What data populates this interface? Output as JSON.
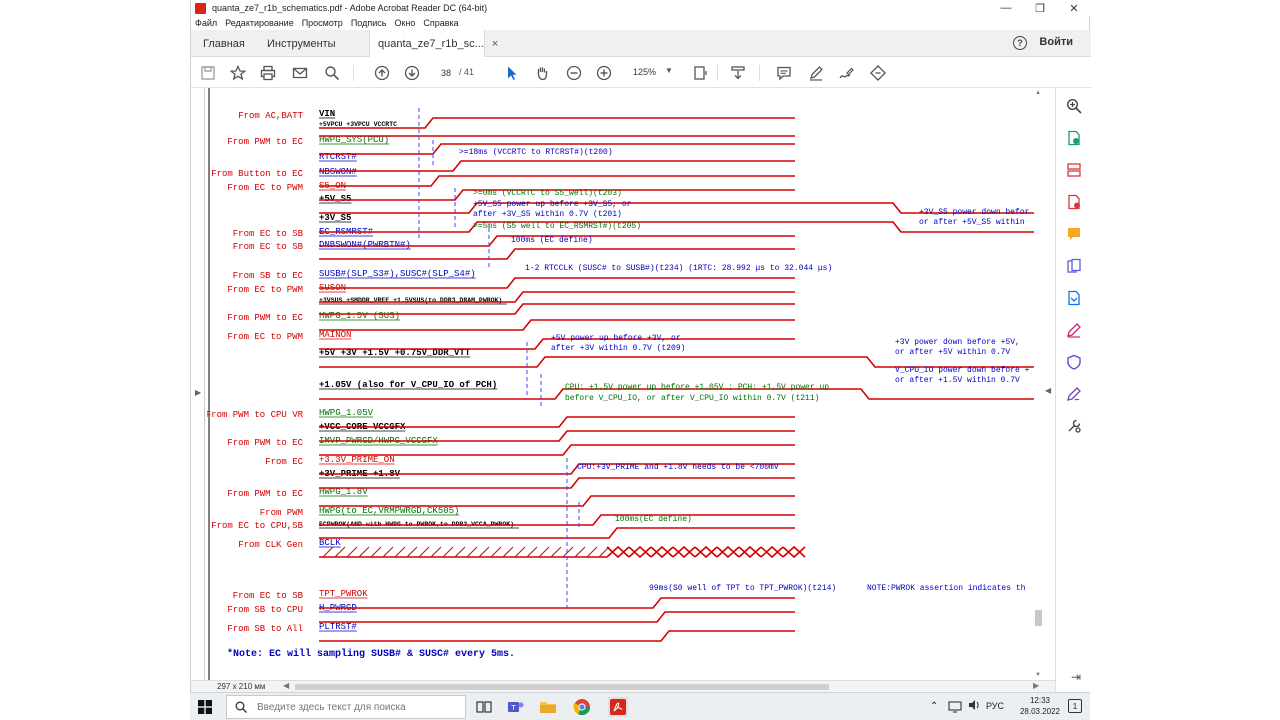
{
  "window": {
    "title": "quanta_ze7_r1b_schematics.pdf - Adobe Acrobat Reader DC (64-bit)",
    "controls": {
      "minimize": "—",
      "maximize": "❐",
      "close": "✕"
    }
  },
  "menu": [
    "Файл",
    "Редактирование",
    "Просмотр",
    "Подпись",
    "Окно",
    "Справка"
  ],
  "tabs": {
    "home": "Главная",
    "tools": "Инструменты",
    "document": "quanta_ze7_r1b_sc...",
    "close": "×",
    "help": "?",
    "signin": "Войти"
  },
  "toolbar": {
    "page_current": "38",
    "page_total": "/ 41",
    "zoom": "125%"
  },
  "schematic": {
    "signals": [
      {
        "source": "From AC,BATT",
        "name": "VIN",
        "color": "#000"
      },
      {
        "source": "",
        "name": "+5VPCU +3VPCU VCCRTC",
        "color": "#000",
        "small": true
      },
      {
        "source": "From PWM to EC",
        "name": "HWPG_SYS(PCU)",
        "color": "#007000"
      },
      {
        "source": "",
        "name": "RTCRST#",
        "color": "#0000c0"
      },
      {
        "source": "From Button to EC",
        "name": "NBSWON#",
        "color": "#0000c0"
      },
      {
        "source": "From EC to PWM",
        "name": "S5_ON",
        "color": "#d40000"
      },
      {
        "source": "",
        "name": "+5V_S5",
        "color": "#000"
      },
      {
        "source": "",
        "name": "+3V_S5",
        "color": "#000"
      },
      {
        "source": "From EC to SB",
        "name": "EC_RSMRST#",
        "color": "#0000c0"
      },
      {
        "source": "From EC to SB",
        "name": "DNBSWON#(PWRBTN#)",
        "color": "#0000c0"
      },
      {
        "source": "From SB to EC",
        "name": "SUSB#(SLP_S3#),SUSC#(SLP_S4#)",
        "color": "#0000c0"
      },
      {
        "source": "From EC to PWM",
        "name": "SUSON",
        "color": "#d40000"
      },
      {
        "source": "",
        "name": "+3VSUS +SMDDR_VREF +1.5VSUS(to DDR3_DRAM_PWROK)",
        "color": "#000",
        "small": true
      },
      {
        "source": "From PWM to EC",
        "name": "HWPG_1.5V (SUS)",
        "color": "#007000"
      },
      {
        "source": "From EC to PWM",
        "name": "MAINON",
        "color": "#d40000"
      },
      {
        "source": "",
        "name": "+5V +3V +1.5V +0.75V_DDR_VTT",
        "color": "#000"
      },
      {
        "source": "",
        "name": "+1.05V (also for V_CPU_IO of PCH)",
        "color": "#000"
      },
      {
        "source": "From PWM to CPU VR",
        "name": "HWPG_1.05V",
        "color": "#007000"
      },
      {
        "source": "",
        "name": "+VCC_CORE VCCGFX",
        "color": "#000"
      },
      {
        "source": "From PWM to EC",
        "name": "IMVP_PWRGD/HWPG_VCCGFX",
        "color": "#007000"
      },
      {
        "source": "From EC",
        "name": "+3.3V_PRIME_ON",
        "color": "#d40000"
      },
      {
        "source": "",
        "name": "+3V_PRIME +1.8V",
        "color": "#000"
      },
      {
        "source": "From PWM to EC",
        "name": "HWPG_1.8V",
        "color": "#007000"
      },
      {
        "source": "From PWM",
        "name": "HWPG(to EC,VRMPWRGD,CK505)",
        "color": "#007000"
      },
      {
        "source": "From EC to CPU,SB",
        "name": "ECPWROK(AND with HWPG to PWROK,to DDR3_VCCA_PWROK)",
        "color": "#000",
        "small": true
      },
      {
        "source": "From CLK Gen",
        "name": "BCLK",
        "color": "#0000c0"
      },
      {
        "source": "From EC to SB",
        "name": "TPT_PWROK",
        "color": "#d40000"
      },
      {
        "source": "From SB to CPU",
        "name": "H_PWRGD",
        "color": "#0000c0"
      },
      {
        "source": "From SB to All",
        "name": "PLTRST#",
        "color": "#0000c0"
      }
    ],
    "annotations": [
      {
        "text": ">=18ms (VCCRTC to RTCRST#)(t200)",
        "color": "#0000c0"
      },
      {
        "text": ">=0ms (VCCRTC to S5_well)(t203)",
        "color": "#007000"
      },
      {
        "text": "+5V_S5 power up before +3V_S5, or",
        "color": "#0000c0"
      },
      {
        "text": "after +3V_S5 within 0.7V (t201)",
        "color": "#0000c0"
      },
      {
        "text": "+3V_S5 power down befor",
        "color": "#0000c0"
      },
      {
        "text": "or after +5V_S5 within",
        "color": "#0000c0"
      },
      {
        "text": ">=5ms (S5 well to EC_RSMRST#)(t205)",
        "color": "#007000"
      },
      {
        "text": "100ms (EC define)",
        "color": "#0000c0"
      },
      {
        "text": "1-2 RTCCLK (SUSC# to SUSB#)(t234) (1RTC: 28.992 μs to 32.044 μs)",
        "color": "#0000c0"
      },
      {
        "text": "+5V power up before +3V, or",
        "color": "#0000c0"
      },
      {
        "text": "after +3V within 0.7V (t209)",
        "color": "#0000c0"
      },
      {
        "text": "+3V power down before +5V,",
        "color": "#0000c0"
      },
      {
        "text": "or after +5V within 0.7V",
        "color": "#0000c0"
      },
      {
        "text": "CPU: +1.5V power up before +1.05V ; PCH: +1.5V power up",
        "color": "#007000"
      },
      {
        "text": "before V_CPU_IO, or after V_CPU_IO within 0.7V (t211)",
        "color": "#007000"
      },
      {
        "text": "V_CPU_IO power down before +",
        "color": "#0000c0"
      },
      {
        "text": "or after +1.5V within 0.7V",
        "color": "#0000c0"
      },
      {
        "text": "CPU:+3V_PRIME and +1.8V needs to be <700mV",
        "color": "#0000c0"
      },
      {
        "text": "100ms(EC define)",
        "color": "#007000"
      },
      {
        "text": "99ms(S0 well of TPT to TPT_PWROK)(t214)",
        "color": "#0000c0"
      },
      {
        "text": "NOTE:PWROK assertion indicates th",
        "color": "#0000c0"
      }
    ],
    "note": "*Note: EC will sampling SUSB# & SUSC# every 5ms."
  },
  "statusbar": {
    "size": "297 x 210 мм"
  },
  "taskbar": {
    "search_placeholder": "Введите здесь текст для поиска",
    "lang": "РУС",
    "time": "12:33",
    "date": "28.03.2022",
    "notif": "1"
  },
  "colors": {
    "accent_red": "#d40000",
    "tab_bg": "#f0f0f0",
    "toolbar_blue": "#1b6ac9"
  }
}
